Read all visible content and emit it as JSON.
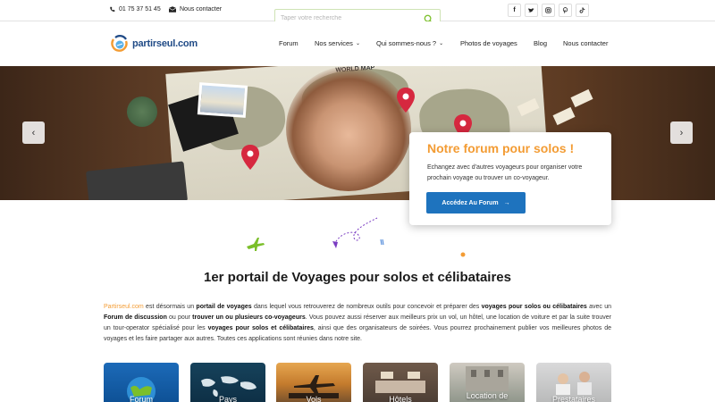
{
  "topbar": {
    "phone": "01 75 37 51 45",
    "contact": "Nous contacter",
    "search_placeholder": "Taper votre recherche",
    "socials": [
      "f",
      "t",
      "ig",
      "p",
      "tk"
    ]
  },
  "logo": {
    "text": "partirseul.com"
  },
  "nav": {
    "items": [
      {
        "label": "Forum"
      },
      {
        "label": "Nos services"
      },
      {
        "label": "Qui sommes-nous ?"
      },
      {
        "label": "Photos de voyages"
      },
      {
        "label": "Blog"
      },
      {
        "label": "Nous contacter"
      }
    ]
  },
  "hero": {
    "map_title": "WORLD MAP",
    "card_title": "Notre forum pour solos !",
    "card_text": "Echangez avec d'autres voyageurs pour organiser votre prochain voyage ou trouver un co-voyageur.",
    "card_button": "Accédez Au Forum"
  },
  "main": {
    "heading": "1er portail de Voyages pour solos et célibataires",
    "para": {
      "brand": "Partirseul.com",
      "t1": " est désormais un ",
      "b1": "portail de voyages",
      "t2": " dans lequel vous retrouverez de nombreux outils pour concevoir et préparer des ",
      "b2": "voyages pour solos ou célibataires",
      "t3": " avec un ",
      "b3": "Forum de discussion",
      "t4": " ou pour ",
      "b4": "trouver un ou plusieurs co-voyageurs",
      "t5": ". Vous pouvez aussi réserver aux meilleurs prix un vol, un hôtel, une location de voiture et par la suite trouver un tour-operator spécialisé pour les ",
      "b5": "voyages pour solos et célibataires",
      "t6": ", ainsi que des organisateurs de soirées. Vous pourrez prochainement publier vos meilleures photos de voyages et les faire partager aux autres. Toutes ces applications sont réunies dans notre site."
    },
    "tiles": [
      {
        "label": "Forum"
      },
      {
        "label": "Pays"
      },
      {
        "label": "Vols"
      },
      {
        "label": "Hôtels"
      },
      {
        "label": "Location de"
      },
      {
        "label": "Prestataires"
      }
    ]
  },
  "colors": {
    "accent": "#f39c34",
    "button": "#1e73be",
    "logo": "#1f4a86"
  }
}
